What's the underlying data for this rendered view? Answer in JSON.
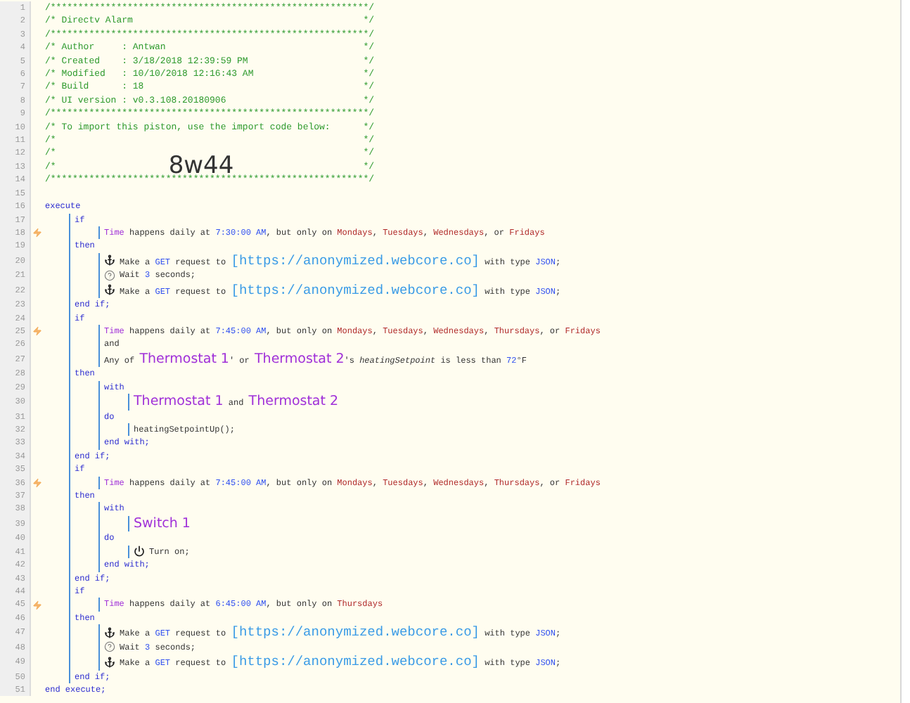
{
  "lines": [
    {
      "number": "1",
      "flag": false,
      "tokens": [
        {
          "kind": "comment",
          "text": "/**********************************************************/"
        }
      ]
    },
    {
      "number": "2",
      "flag": false,
      "tokens": [
        {
          "kind": "comment",
          "text": "/* Directv Alarm"
        }
      ],
      "close": "*/"
    },
    {
      "number": "3",
      "flag": false,
      "tokens": [
        {
          "kind": "comment",
          "text": "/**********************************************************/"
        }
      ]
    },
    {
      "number": "4",
      "flag": false,
      "tokens": [
        {
          "kind": "comment",
          "text": "/* Author     : Antwan"
        }
      ],
      "close": "*/"
    },
    {
      "number": "5",
      "flag": false,
      "tokens": [
        {
          "kind": "comment",
          "text": "/* Created    : 3/18/2018 12:39:59 PM"
        }
      ],
      "close": "*/"
    },
    {
      "number": "6",
      "flag": false,
      "tokens": [
        {
          "kind": "comment",
          "text": "/* Modified   : 10/10/2018 12:16:43 AM"
        }
      ],
      "close": "*/"
    },
    {
      "number": "7",
      "flag": false,
      "tokens": [
        {
          "kind": "comment",
          "text": "/* Build      : 18"
        }
      ],
      "close": "*/"
    },
    {
      "number": "8",
      "flag": false,
      "tokens": [
        {
          "kind": "comment",
          "text": "/* UI version : v0.3.108.20180906"
        }
      ],
      "close": "*/"
    },
    {
      "number": "9",
      "flag": false,
      "tokens": [
        {
          "kind": "comment",
          "text": "/**********************************************************/"
        }
      ]
    },
    {
      "number": "10",
      "flag": false,
      "tokens": [
        {
          "kind": "comment",
          "text": "/* To import this piston, use the import code below:"
        }
      ],
      "close": "*/"
    },
    {
      "number": "11",
      "flag": false,
      "tokens": [
        {
          "kind": "comment",
          "text": "/*"
        }
      ],
      "close": "*/"
    },
    {
      "number": "12",
      "flag": false,
      "tokens": [
        {
          "kind": "comment",
          "text": "/*"
        }
      ],
      "close": "*/"
    },
    {
      "number": "13",
      "flag": false,
      "tokens": [
        {
          "kind": "comment",
          "text": "/*"
        },
        {
          "kind": "code",
          "text": "8w44"
        }
      ],
      "close": "*/"
    },
    {
      "number": "14",
      "flag": false,
      "tokens": [
        {
          "kind": "comment",
          "text": "/**********************************************************/"
        }
      ]
    },
    {
      "number": "15",
      "flag": false
    },
    {
      "number": "16",
      "flag": false,
      "tokens": [
        {
          "kind": "keyword",
          "text": "execute"
        }
      ],
      "children": [
        {
          "number": "17",
          "flag": false,
          "tokens": [
            {
              "kind": "keyword",
              "text": "if"
            }
          ],
          "children": [
            {
              "number": "18",
              "flag": true,
              "tokens": [
                {
                  "kind": "attribute",
                  "text": "Time"
                },
                {
                  "kind": "text",
                  "text": " happens daily at "
                },
                {
                  "kind": "value",
                  "text": "7:30:00 AM"
                },
                {
                  "kind": "text",
                  "text": ", but only on "
                },
                {
                  "kind": "day",
                  "text": "Mondays"
                },
                {
                  "kind": "text",
                  "text": ", "
                },
                {
                  "kind": "day",
                  "text": "Tuesdays"
                },
                {
                  "kind": "text",
                  "text": ", "
                },
                {
                  "kind": "day",
                  "text": "Wednesdays"
                },
                {
                  "kind": "text",
                  "text": ", or "
                },
                {
                  "kind": "day",
                  "text": "Fridays"
                }
              ]
            }
          ]
        },
        {
          "number": "19",
          "flag": false,
          "tokens": [
            {
              "kind": "keyword",
              "text": "then"
            }
          ],
          "children": [
            {
              "number": "20",
              "kind": "request",
              "flag": false,
              "tokens": [
                {
                  "kind": "text",
                  "text": "Make a "
                },
                {
                  "kind": "value",
                  "text": "GET"
                },
                {
                  "kind": "text",
                  "text": " request to "
                },
                {
                  "kind": "url",
                  "text": "[https://anonymized.webcore.co]"
                },
                {
                  "kind": "text",
                  "text": " with type "
                },
                {
                  "kind": "value",
                  "text": "JSON"
                },
                {
                  "kind": "text",
                  "text": ";"
                }
              ]
            },
            {
              "number": "21",
              "kind": "wait",
              "flag": false,
              "tokens": [
                {
                  "kind": "text",
                  "text": "Wait "
                },
                {
                  "kind": "value",
                  "text": "3"
                },
                {
                  "kind": "text",
                  "text": " seconds;"
                }
              ]
            },
            {
              "number": "22",
              "kind": "request",
              "flag": false,
              "tokens": [
                {
                  "kind": "text",
                  "text": "Make a "
                },
                {
                  "kind": "value",
                  "text": "GET"
                },
                {
                  "kind": "text",
                  "text": " request to "
                },
                {
                  "kind": "url",
                  "text": "[https://anonymized.webcore.co]"
                },
                {
                  "kind": "text",
                  "text": " with type "
                },
                {
                  "kind": "value",
                  "text": "JSON"
                },
                {
                  "kind": "text",
                  "text": ";"
                }
              ]
            }
          ]
        },
        {
          "number": "23",
          "flag": false,
          "tokens": [
            {
              "kind": "keyword",
              "text": "end if;"
            }
          ]
        },
        {
          "number": "24",
          "flag": false,
          "tokens": [
            {
              "kind": "keyword",
              "text": "if"
            }
          ],
          "children": [
            {
              "number": "25",
              "flag": true,
              "tokens": [
                {
                  "kind": "attribute",
                  "text": "Time"
                },
                {
                  "kind": "text",
                  "text": " happens daily at "
                },
                {
                  "kind": "value",
                  "text": "7:45:00 AM"
                },
                {
                  "kind": "text",
                  "text": ", but only on "
                },
                {
                  "kind": "day",
                  "text": "Mondays"
                },
                {
                  "kind": "text",
                  "text": ", "
                },
                {
                  "kind": "day",
                  "text": "Tuesdays"
                },
                {
                  "kind": "text",
                  "text": ", "
                },
                {
                  "kind": "day",
                  "text": "Wednesdays"
                },
                {
                  "kind": "text",
                  "text": ", "
                },
                {
                  "kind": "day",
                  "text": "Thursdays"
                },
                {
                  "kind": "text",
                  "text": ", or "
                },
                {
                  "kind": "day",
                  "text": "Fridays"
                }
              ]
            },
            {
              "number": "26",
              "flag": false,
              "tokens": [
                {
                  "kind": "text",
                  "text": "and"
                }
              ]
            },
            {
              "number": "27",
              "flag": false,
              "tokens": [
                {
                  "kind": "text",
                  "text": "Any of "
                },
                {
                  "kind": "device",
                  "text": "Thermostat 1"
                },
                {
                  "kind": "text",
                  "text": "' or "
                },
                {
                  "kind": "device",
                  "text": "Thermostat 2"
                },
                {
                  "kind": "text",
                  "text": "'s "
                },
                {
                  "kind": "italic",
                  "text": "heatingSetpoint"
                },
                {
                  "kind": "text",
                  "text": " is less than "
                },
                {
                  "kind": "value",
                  "text": "72"
                },
                {
                  "kind": "text",
                  "text": "°F"
                }
              ]
            }
          ]
        },
        {
          "number": "28",
          "flag": false,
          "tokens": [
            {
              "kind": "keyword",
              "text": "then"
            }
          ],
          "children": [
            {
              "number": "29",
              "flag": false,
              "tokens": [
                {
                  "kind": "keyword",
                  "text": "with"
                }
              ],
              "children": [
                {
                  "number": "30",
                  "flag": false,
                  "tokens": [
                    {
                      "kind": "device",
                      "text": "Thermostat 1"
                    },
                    {
                      "kind": "text",
                      "text": " and "
                    },
                    {
                      "kind": "device",
                      "text": "Thermostat 2"
                    }
                  ]
                }
              ]
            },
            {
              "number": "31",
              "flag": false,
              "tokens": [
                {
                  "kind": "keyword",
                  "text": "do"
                }
              ],
              "children": [
                {
                  "number": "32",
                  "flag": false,
                  "tokens": [
                    {
                      "kind": "text",
                      "text": "heatingSetpointUp();"
                    }
                  ]
                }
              ]
            },
            {
              "number": "33",
              "flag": false,
              "tokens": [
                {
                  "kind": "keyword",
                  "text": "end with;"
                }
              ]
            }
          ]
        },
        {
          "number": "34",
          "flag": false,
          "tokens": [
            {
              "kind": "keyword",
              "text": "end if;"
            }
          ]
        },
        {
          "number": "35",
          "flag": false,
          "tokens": [
            {
              "kind": "keyword",
              "text": "if"
            }
          ],
          "children": [
            {
              "number": "36",
              "flag": true,
              "tokens": [
                {
                  "kind": "attribute",
                  "text": "Time"
                },
                {
                  "kind": "text",
                  "text": " happens daily at "
                },
                {
                  "kind": "value",
                  "text": "7:45:00 AM"
                },
                {
                  "kind": "text",
                  "text": ", but only on "
                },
                {
                  "kind": "day",
                  "text": "Mondays"
                },
                {
                  "kind": "text",
                  "text": ", "
                },
                {
                  "kind": "day",
                  "text": "Tuesdays"
                },
                {
                  "kind": "text",
                  "text": ", "
                },
                {
                  "kind": "day",
                  "text": "Wednesdays"
                },
                {
                  "kind": "text",
                  "text": ", "
                },
                {
                  "kind": "day",
                  "text": "Thursdays"
                },
                {
                  "kind": "text",
                  "text": ", or "
                },
                {
                  "kind": "day",
                  "text": "Fridays"
                }
              ]
            }
          ]
        },
        {
          "number": "37",
          "flag": false,
          "tokens": [
            {
              "kind": "keyword",
              "text": "then"
            }
          ],
          "children": [
            {
              "number": "38",
              "flag": false,
              "tokens": [
                {
                  "kind": "keyword",
                  "text": "with"
                }
              ],
              "children": [
                {
                  "number": "39",
                  "flag": false,
                  "tokens": [
                    {
                      "kind": "device",
                      "text": "Switch 1"
                    }
                  ]
                }
              ]
            },
            {
              "number": "40",
              "flag": false,
              "tokens": [
                {
                  "kind": "keyword",
                  "text": "do"
                }
              ],
              "children": [
                {
                  "number": "41",
                  "kind": "command",
                  "flag": false,
                  "tokens": [
                    {
                      "kind": "text",
                      "text": "Turn on;"
                    }
                  ]
                }
              ]
            },
            {
              "number": "42",
              "flag": false,
              "tokens": [
                {
                  "kind": "keyword",
                  "text": "end with;"
                }
              ]
            }
          ]
        },
        {
          "number": "43",
          "flag": false,
          "tokens": [
            {
              "kind": "keyword",
              "text": "end if;"
            }
          ]
        },
        {
          "number": "44",
          "flag": false,
          "tokens": [
            {
              "kind": "keyword",
              "text": "if"
            }
          ],
          "children": [
            {
              "number": "45",
              "flag": true,
              "tokens": [
                {
                  "kind": "attribute",
                  "text": "Time"
                },
                {
                  "kind": "text",
                  "text": " happens daily at "
                },
                {
                  "kind": "value",
                  "text": "6:45:00 AM"
                },
                {
                  "kind": "text",
                  "text": ", but only on "
                },
                {
                  "kind": "day",
                  "text": "Thursdays"
                }
              ]
            }
          ]
        },
        {
          "number": "46",
          "flag": false,
          "tokens": [
            {
              "kind": "keyword",
              "text": "then"
            }
          ],
          "children": [
            {
              "number": "47",
              "kind": "request",
              "flag": false,
              "tokens": [
                {
                  "kind": "text",
                  "text": "Make a "
                },
                {
                  "kind": "value",
                  "text": "GET"
                },
                {
                  "kind": "text",
                  "text": " request to "
                },
                {
                  "kind": "url",
                  "text": "[https://anonymized.webcore.co]"
                },
                {
                  "kind": "text",
                  "text": " with type "
                },
                {
                  "kind": "value",
                  "text": "JSON"
                },
                {
                  "kind": "text",
                  "text": ";"
                }
              ]
            },
            {
              "number": "48",
              "kind": "wait",
              "flag": false,
              "tokens": [
                {
                  "kind": "text",
                  "text": "Wait "
                },
                {
                  "kind": "value",
                  "text": "3"
                },
                {
                  "kind": "text",
                  "text": " seconds;"
                }
              ]
            },
            {
              "number": "49",
              "kind": "request",
              "flag": false,
              "tokens": [
                {
                  "kind": "text",
                  "text": "Make a "
                },
                {
                  "kind": "value",
                  "text": "GET"
                },
                {
                  "kind": "text",
                  "text": " request to "
                },
                {
                  "kind": "url",
                  "text": "[https://anonymized.webcore.co]"
                },
                {
                  "kind": "text",
                  "text": " with type "
                },
                {
                  "kind": "value",
                  "text": "JSON"
                },
                {
                  "kind": "text",
                  "text": ";"
                }
              ]
            }
          ]
        },
        {
          "number": "50",
          "flag": false,
          "tokens": [
            {
              "kind": "keyword",
              "text": "end if;"
            }
          ]
        }
      ]
    },
    {
      "number": "51",
      "flag": false,
      "tokens": [
        {
          "kind": "keyword",
          "text": "end execute;"
        }
      ]
    }
  ]
}
